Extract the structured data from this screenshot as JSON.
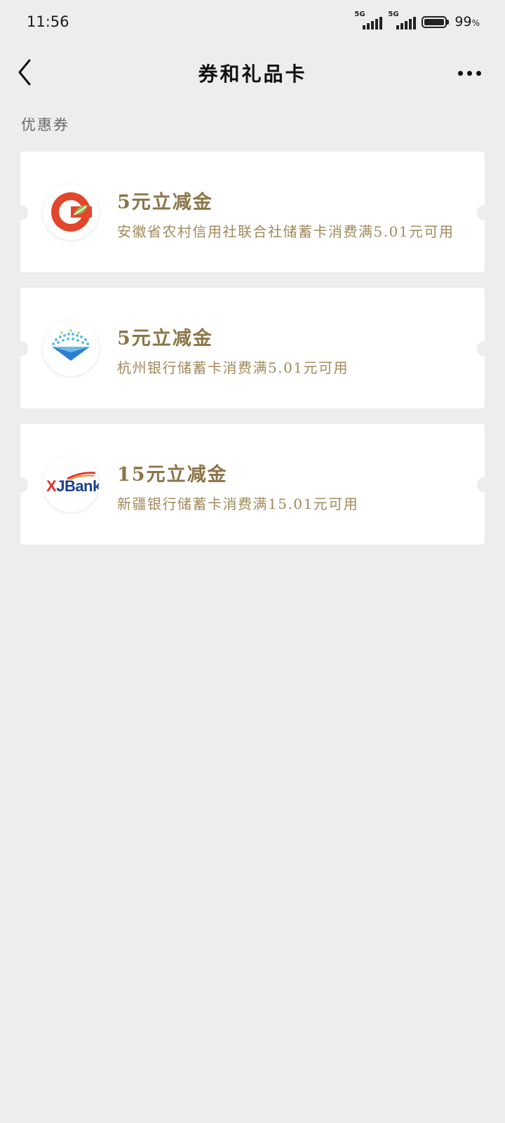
{
  "status_bar": {
    "time": "11:56",
    "signal1_tag": "5G",
    "signal2_tag": "5G",
    "battery_percent": "99",
    "battery_unit": "%",
    "battery_level": 0.99
  },
  "nav": {
    "title": "券和礼品卡",
    "back_icon": "chevron-left-icon",
    "more_icon": "more-horizontal-icon"
  },
  "section": {
    "label": "优惠券"
  },
  "coupons": [
    {
      "title": "5元立减金",
      "description": "安徽省农村信用社联合社储蓄卡消费满5.01元可用",
      "logo": "anhui-rural-credit-logo"
    },
    {
      "title": "5元立减金",
      "description": "杭州银行储蓄卡消费满5.01元可用",
      "logo": "hangzhou-bank-logo"
    },
    {
      "title": "15元立减金",
      "description": "新疆银行储蓄卡消费满15.01元可用",
      "logo": "xjbank-logo",
      "logo_text_x": "X",
      "logo_text_j": "J",
      "logo_text_rest": "Bank"
    }
  ],
  "colors": {
    "background": "#ededed",
    "card": "#ffffff",
    "title_gold": "#8b7548",
    "desc_gold": "#a08a5c"
  }
}
